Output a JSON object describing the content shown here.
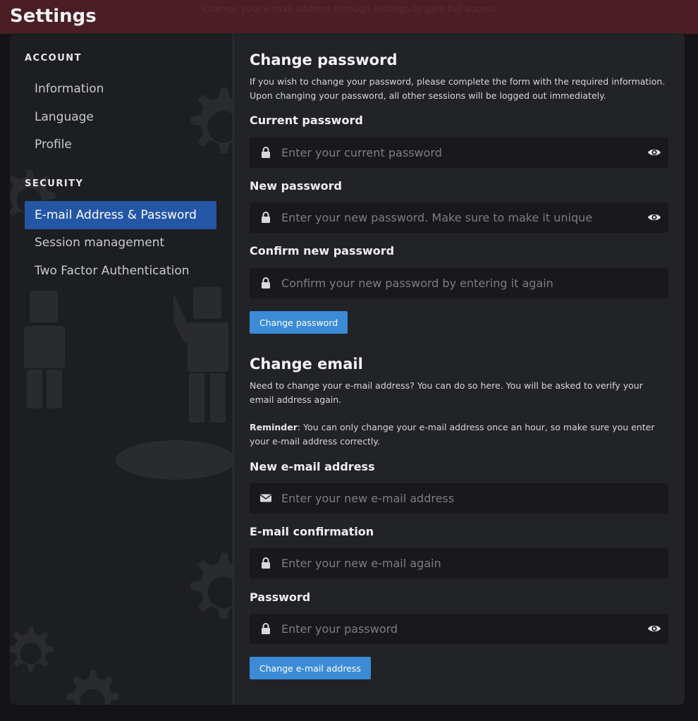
{
  "banner": {
    "text": "Change your e-mail address through settings to gain full access"
  },
  "page": {
    "title": "Settings"
  },
  "sidebar": {
    "account_heading": "ACCOUNT",
    "account_items": [
      {
        "label": "Information"
      },
      {
        "label": "Language"
      },
      {
        "label": "Profile"
      }
    ],
    "security_heading": "SECURITY",
    "security_items": [
      {
        "label": "E-mail Address & Password",
        "active": true
      },
      {
        "label": "Session management"
      },
      {
        "label": "Two Factor Authentication"
      }
    ]
  },
  "change_password": {
    "title": "Change password",
    "description": "If you wish to change your password, please complete the form with the required information. Upon changing your password, all other sessions will be logged out immediately.",
    "current": {
      "label": "Current password",
      "placeholder": "Enter your current password",
      "icon": "lock-icon",
      "toggle_icon": "eye-icon"
    },
    "new": {
      "label": "New password",
      "placeholder": "Enter your new password. Make sure to make it unique",
      "icon": "lock-icon",
      "toggle_icon": "eye-icon"
    },
    "confirm": {
      "label": "Confirm new password",
      "placeholder": "Confirm your new password by entering it again",
      "icon": "lock-icon"
    },
    "button": "Change password"
  },
  "change_email": {
    "title": "Change email",
    "description": "Need to change your e-mail address? You can do so here. You will be asked to verify your email address again.",
    "reminder_label": "Reminder",
    "reminder_text": ": You can only change your e-mail address once an hour, so make sure you enter your e-mail address correctly.",
    "new_email": {
      "label": "New e-mail address",
      "placeholder": "Enter your new e-mail address",
      "icon": "envelope-icon"
    },
    "confirm_email": {
      "label": "E-mail confirmation",
      "placeholder": "Enter your new e-mail again",
      "icon": "lock-icon"
    },
    "password": {
      "label": "Password",
      "placeholder": "Enter your password",
      "icon": "lock-icon",
      "toggle_icon": "eye-icon"
    },
    "button": "Change e-mail address"
  },
  "colors": {
    "accent": "#2456a6",
    "button": "#3c8bd6",
    "panel": "#222326",
    "sidebar": "#1d1e21",
    "banner": "#4a1e24"
  }
}
